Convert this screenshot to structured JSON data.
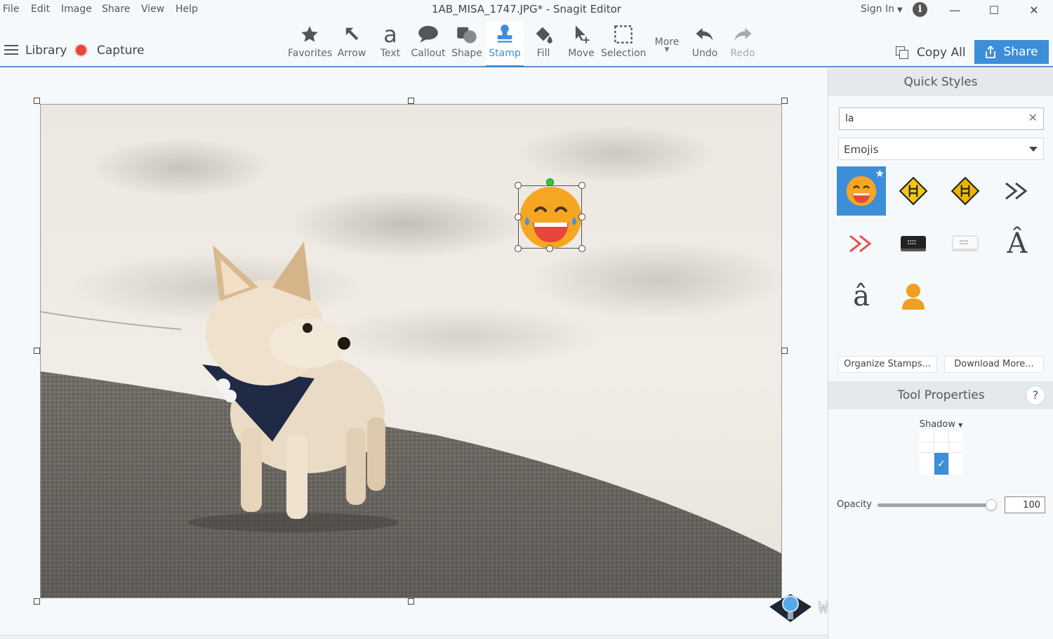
{
  "window": {
    "title": "1AB_MISA_1747.JPG* - Snagit Editor",
    "menus": [
      "File",
      "Edit",
      "Image",
      "Share",
      "View",
      "Help"
    ],
    "sign_in": "Sign In",
    "minimize": "—",
    "maximize": "☐",
    "close": "✕"
  },
  "toolbar": {
    "library": "Library",
    "capture": "Capture",
    "tools": [
      {
        "label": "Favorites",
        "icon": "star-icon"
      },
      {
        "label": "Arrow",
        "icon": "arrow-icon"
      },
      {
        "label": "Text",
        "icon": "text-icon",
        "glyph": "a"
      },
      {
        "label": "Callout",
        "icon": "callout-icon"
      },
      {
        "label": "Shape",
        "icon": "shape-icon"
      },
      {
        "label": "Stamp",
        "icon": "stamp-icon",
        "active": true
      },
      {
        "label": "Fill",
        "icon": "fill-icon"
      },
      {
        "label": "Move",
        "icon": "move-icon"
      },
      {
        "label": "Selection",
        "icon": "selection-icon"
      },
      {
        "label": "More",
        "icon": "more-caret"
      },
      {
        "label": "Undo",
        "icon": "undo-icon"
      },
      {
        "label": "Redo",
        "icon": "redo-icon",
        "disabled": true
      }
    ],
    "copy_all": "Copy All",
    "share": "Share"
  },
  "quick_styles": {
    "title": "Quick Styles",
    "search_value": "la",
    "category": "Emojis",
    "stamps": [
      "laughing-emoji-stamp",
      "ladder-warning-sign-yellow-stamp",
      "ladder-warning-sign-orange-stamp",
      "double-chevron-gray-stamp",
      "double-chevron-red-stamp",
      "keyboard-dark-stamp",
      "keyboard-light-stamp",
      "a-circumflex-uppercase-stamp",
      "a-circumflex-lowercase-stamp",
      "person-avatar-stamp"
    ],
    "letter_upper": "Â",
    "letter_lower": "â",
    "organize": "Organize Stamps...",
    "download": "Download More..."
  },
  "tool_properties": {
    "title": "Tool Properties",
    "help": "?",
    "shadow": "Shadow",
    "opacity_label": "Opacity",
    "opacity_value": "100",
    "opacity_fraction": 1.0
  },
  "watermark": "WWW.CRAVINGTECH.COM",
  "colors": {
    "accent": "#3d8ed8",
    "record": "#e8453c",
    "emoji_face": "#f5a623",
    "emoji_mouth": "#e8453c",
    "emoji_tears": "#4a90e2"
  }
}
